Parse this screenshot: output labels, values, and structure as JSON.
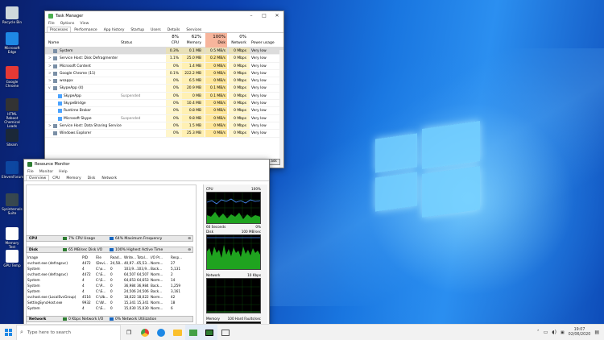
{
  "desktop": {
    "icons": [
      {
        "label": "Recycle Bin",
        "color": "#cfd8dc"
      },
      {
        "label": "Microsoft Edge",
        "color": "#1e88e5"
      },
      {
        "label": "Google Chrome",
        "color": "#e53935"
      },
      {
        "label": "HTML Reboot Chemical Loads",
        "color": "#333333"
      },
      {
        "label": "Steam",
        "color": "#1b2838"
      },
      {
        "label": "ElevenForum",
        "color": "#0d47a1"
      },
      {
        "label": "Sysinternals Suite",
        "color": "#37474f"
      },
      {
        "label": "Memory Test",
        "color": "#ffffff"
      },
      {
        "label": "GPU Temp",
        "color": "#ffffff"
      }
    ]
  },
  "task_manager": {
    "title": "Task Manager",
    "menu": [
      "File",
      "Options",
      "View"
    ],
    "tabs": [
      "Processes",
      "Performance",
      "App history",
      "Startup",
      "Users",
      "Details",
      "Services"
    ],
    "active_tab": "Processes",
    "headers": {
      "name": "Name",
      "status": "Status",
      "cpu_pct": "8%",
      "cpu": "CPU",
      "memory_pct": "62%",
      "memory": "Memory",
      "disk_pct": "100%",
      "disk": "Disk",
      "network_pct": "0%",
      "network": "Network",
      "power": "Power usage"
    },
    "rows": [
      {
        "name": "System",
        "status": "",
        "cpu": "0.3%",
        "memory": "0.1 MB",
        "disk": "0.5 MB/s",
        "network": "0 Mbps",
        "power": "Very low",
        "indent": false,
        "expand": ""
      },
      {
        "name": "Service Host: Disk Defragmenter",
        "status": "",
        "cpu": "1.1%",
        "memory": "25.0 MB",
        "disk": "0.2 MB/s",
        "network": "0 Mbps",
        "power": "Very low",
        "indent": false,
        "expand": ">"
      },
      {
        "name": "Microsoft Content",
        "status": "",
        "cpu": "0%",
        "memory": "1.4 MB",
        "disk": "0 MB/s",
        "network": "0 Mbps",
        "power": "Very low",
        "indent": false,
        "expand": ">"
      },
      {
        "name": "Google Chrome (11)",
        "status": "",
        "cpu": "0.1%",
        "memory": "222.2 MB",
        "disk": "0 MB/s",
        "network": "0 Mbps",
        "power": "Very low",
        "indent": false,
        "expand": ">"
      },
      {
        "name": "wsappx",
        "status": "",
        "cpu": "0%",
        "memory": "6.5 MB",
        "disk": "0 MB/s",
        "network": "0 Mbps",
        "power": "Very low",
        "indent": false,
        "expand": ">"
      },
      {
        "name": "SkypeApp (4)",
        "status": "",
        "cpu": "0%",
        "memory": "20.9 MB",
        "disk": "0.1 MB/s",
        "network": "0 Mbps",
        "power": "Very low",
        "indent": false,
        "expand": "v"
      },
      {
        "name": "SkypeApp",
        "status": "Suspended",
        "cpu": "0%",
        "memory": "0 MB",
        "disk": "0.1 MB/s",
        "network": "0 Mbps",
        "power": "Very low",
        "indent": true,
        "expand": ""
      },
      {
        "name": "SkypeBridge",
        "status": "",
        "cpu": "0%",
        "memory": "10.4 MB",
        "disk": "0 MB/s",
        "network": "0 Mbps",
        "power": "Very low",
        "indent": true,
        "expand": ""
      },
      {
        "name": "Runtime Broker",
        "status": "",
        "cpu": "0%",
        "memory": "0.8 MB",
        "disk": "0 MB/s",
        "network": "0 Mbps",
        "power": "Very low",
        "indent": true,
        "expand": ""
      },
      {
        "name": "Microsoft Skype",
        "status": "Suspended",
        "cpu": "0%",
        "memory": "9.8 MB",
        "disk": "0 MB/s",
        "network": "0 Mbps",
        "power": "Very low",
        "indent": true,
        "expand": ""
      },
      {
        "name": "Service Host: Data Sharing Service",
        "status": "",
        "cpu": "0%",
        "memory": "1.5 MB",
        "disk": "0 MB/s",
        "network": "0 Mbps",
        "power": "Very low",
        "indent": false,
        "expand": ">"
      },
      {
        "name": "Windows Explorer",
        "status": "",
        "cpu": "0%",
        "memory": "25.3 MB",
        "disk": "0 MB/s",
        "network": "0 Mbps",
        "power": "Very low",
        "indent": false,
        "expand": ""
      }
    ],
    "end_task": "ask"
  },
  "resource_monitor": {
    "title": "Resource Monitor",
    "menu": [
      "File",
      "Monitor",
      "Help"
    ],
    "tabs": [
      "Overview",
      "CPU",
      "Memory",
      "Disk",
      "Network"
    ],
    "cpu_section": {
      "label": "CPU",
      "a": "7% CPU Usage",
      "b": "64% Maximum Frequency"
    },
    "disk_section": {
      "label": "Disk",
      "a": "65 MB/sec Disk I/O",
      "b": "100% Highest Active Time"
    },
    "network_section": {
      "label": "Network",
      "a": "0 Kbps Network I/O",
      "b": "0% Network Utilization"
    },
    "disk_headers": [
      "Image",
      "PID",
      "File",
      "Read...",
      "Write...",
      "Total...",
      "I/O Pr...",
      "Resp..."
    ],
    "disk_rows": [
      [
        "svchost.exe (defragsvc)",
        "4472",
        "\\Devi...",
        "24,58...",
        "40,97...",
        "65,53...",
        "Norm...",
        "27"
      ],
      [
        "System",
        "4",
        "C:\\o...",
        "0",
        "103,9...",
        "103,9...",
        "Back...",
        "5,131"
      ],
      [
        "svchost.exe (defragsvc)",
        "4472",
        "C:\\S...",
        "0",
        "64,507",
        "64,507",
        "Norm...",
        "2"
      ],
      [
        "System",
        "4",
        "C:\\S...",
        "0",
        "64,653",
        "64,653",
        "Norm...",
        "14"
      ],
      [
        "System",
        "4",
        "C:\\P...",
        "0",
        "36,984",
        "36,984",
        "Back...",
        "1,259"
      ],
      [
        "System",
        "4",
        "C:\\S...",
        "0",
        "24,506",
        "24,506",
        "Back...",
        "3,161"
      ],
      [
        "svchost.exe (LocalSvcGroup)",
        "4516",
        "C:\\Ub...",
        "0",
        "18,022",
        "18,022",
        "Norm...",
        "42"
      ],
      [
        "SettingSyncHost.exe",
        "9932",
        "C:\\W...",
        "0",
        "15,341",
        "15,341",
        "Norm...",
        "18"
      ],
      [
        "System",
        "4",
        "C:\\S...",
        "0",
        "15,030",
        "15,030",
        "Norm...",
        "6"
      ]
    ],
    "graphs": {
      "cpu": {
        "name": "CPU",
        "max": "100%",
        "footer_left": "60 Seconds",
        "footer_right": "0%"
      },
      "disk": {
        "name": "Disk",
        "max": "100 MB/sec",
        "footer_left": "",
        "footer_right": "0"
      },
      "network": {
        "name": "Network",
        "max": "10 Kbps",
        "footer_left": "",
        "footer_right": "0"
      },
      "memory": {
        "name": "Memory",
        "max": "100 Hard Faults/sec",
        "footer_left": "",
        "footer_right": ""
      }
    }
  },
  "taskbar": {
    "search_placeholder": "Type here to search",
    "time": "19:07",
    "date": "02/06/2020"
  }
}
